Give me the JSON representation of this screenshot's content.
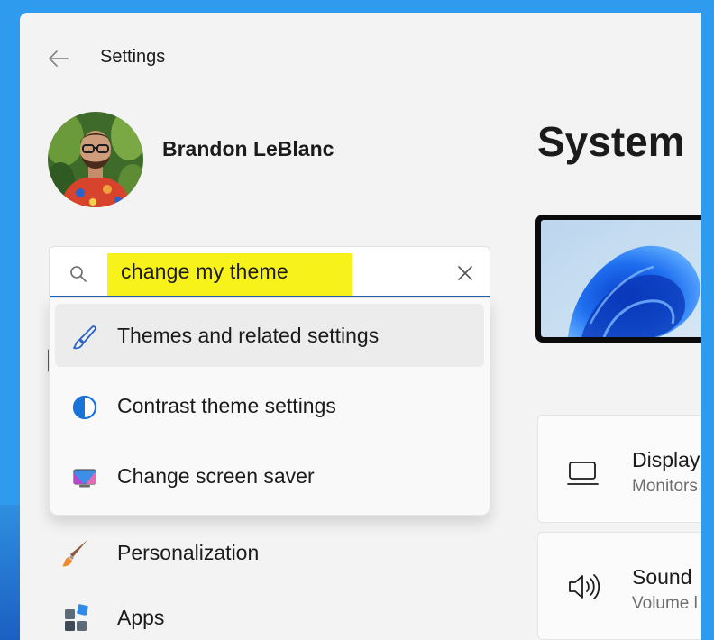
{
  "window": {
    "title": "Settings"
  },
  "user": {
    "name": "Brandon LeBlanc"
  },
  "search": {
    "value": "change my theme",
    "suggestions": [
      {
        "label": "Themes and related settings",
        "icon": "brush-icon"
      },
      {
        "label": "Contrast theme settings",
        "icon": "contrast-icon"
      },
      {
        "label": "Change screen saver",
        "icon": "screen-saver-icon"
      }
    ]
  },
  "nav": {
    "items": [
      {
        "label": "Personalization",
        "icon": "paintbrush-icon"
      },
      {
        "label": "Apps",
        "icon": "apps-icon"
      }
    ]
  },
  "main": {
    "title": "System",
    "cards": [
      {
        "title": "Display",
        "subtitle": "Monitors",
        "icon": "monitor-icon"
      },
      {
        "title": "Sound",
        "subtitle": "Volume l",
        "icon": "speaker-icon"
      }
    ]
  },
  "colors": {
    "accent": "#1d63b8",
    "highlight": "#f7f219",
    "frame": "#2e9bef"
  }
}
